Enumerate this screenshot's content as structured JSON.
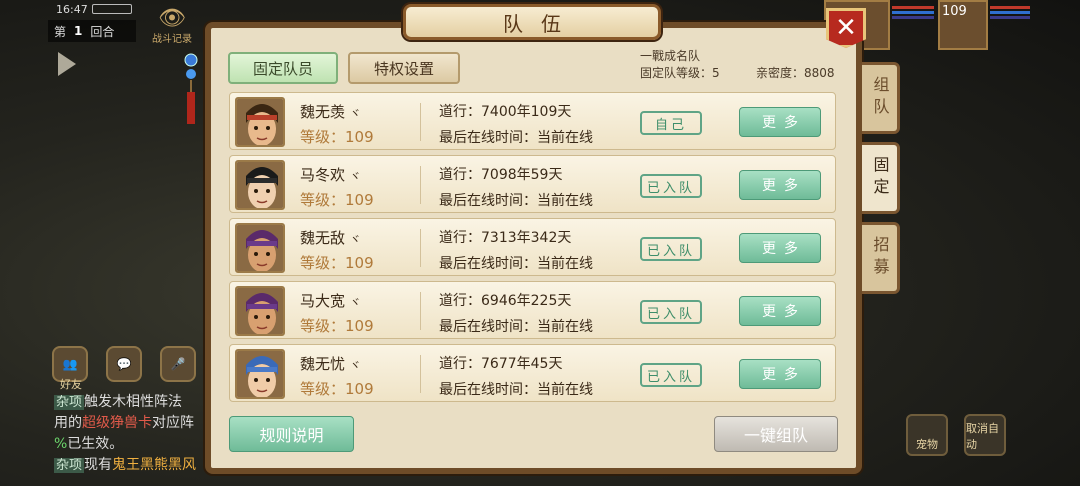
{
  "status": {
    "time": "16:47"
  },
  "round": {
    "label_prefix": "第",
    "number": "1",
    "label_suffix": "回合"
  },
  "battle_record": "战斗记录",
  "panel": {
    "title": "队伍",
    "close": "✕",
    "tabs": {
      "fixed": "固定队员",
      "privilege": "特权设置"
    },
    "team_info": {
      "name": "一戰成名队",
      "level": "固定队等级：5",
      "intimacy": "亲密度：8808"
    },
    "members": [
      {
        "name": "魏无羡",
        "level": "等级：109",
        "daohang": "道行：7400年109天",
        "online": "最后在线时间：当前在线",
        "status": "自己",
        "more": "更多",
        "colors": {
          "hair": "#3a2612",
          "skin": "#e8b98c",
          "band": "#b8402a"
        }
      },
      {
        "name": "马冬欢",
        "level": "等级：109",
        "daohang": "道行：7098年59天",
        "online": "最后在线时间：当前在线",
        "status": "已入队",
        "more": "更多",
        "colors": {
          "hair": "#1a1a1a",
          "skin": "#f0d0b0",
          "band": "#2b2b2b"
        }
      },
      {
        "name": "魏无敌",
        "level": "等级：109",
        "daohang": "道行：7313年342天",
        "online": "最后在线时间：当前在线",
        "status": "已入队",
        "more": "更多",
        "colors": {
          "hair": "#5a2a6a",
          "skin": "#d8a070",
          "band": "#6a3a8a"
        }
      },
      {
        "name": "马大宽",
        "level": "等级：109",
        "daohang": "道行：6946年225天",
        "online": "最后在线时间：当前在线",
        "status": "已入队",
        "more": "更多",
        "colors": {
          "hair": "#5a2a6a",
          "skin": "#d8a070",
          "band": "#6a3a8a"
        }
      },
      {
        "name": "魏无忧",
        "level": "等级：109",
        "daohang": "道行：7677年45天",
        "online": "最后在线时间：当前在线",
        "status": "已入队",
        "more": "更多",
        "colors": {
          "hair": "#3a6ab8",
          "skin": "#f0cca8",
          "band": "#4a7ac8"
        }
      }
    ],
    "buttons": {
      "rules": "规则说明",
      "one_click": "一键组队"
    },
    "side_tabs": [
      "组队",
      "固定",
      "招募"
    ]
  },
  "chat": {
    "icons": {
      "friends": "好友",
      "message": "💬",
      "voice": "🎤"
    },
    "friends_label": "好友",
    "lines": [
      {
        "tag": "杂项",
        "text": "触发木相性阵法"
      },
      {
        "pre": "用的",
        "red": "超级狰兽卡",
        "post": "对应阵"
      },
      {
        "g": "%",
        "text": "已生效。"
      },
      {
        "tag": "杂项",
        "pre": "现有",
        "o": "鬼王黑熊黑风"
      }
    ]
  },
  "hud": {
    "level": "109",
    "pet": "宠物",
    "auto": "取消自动"
  }
}
